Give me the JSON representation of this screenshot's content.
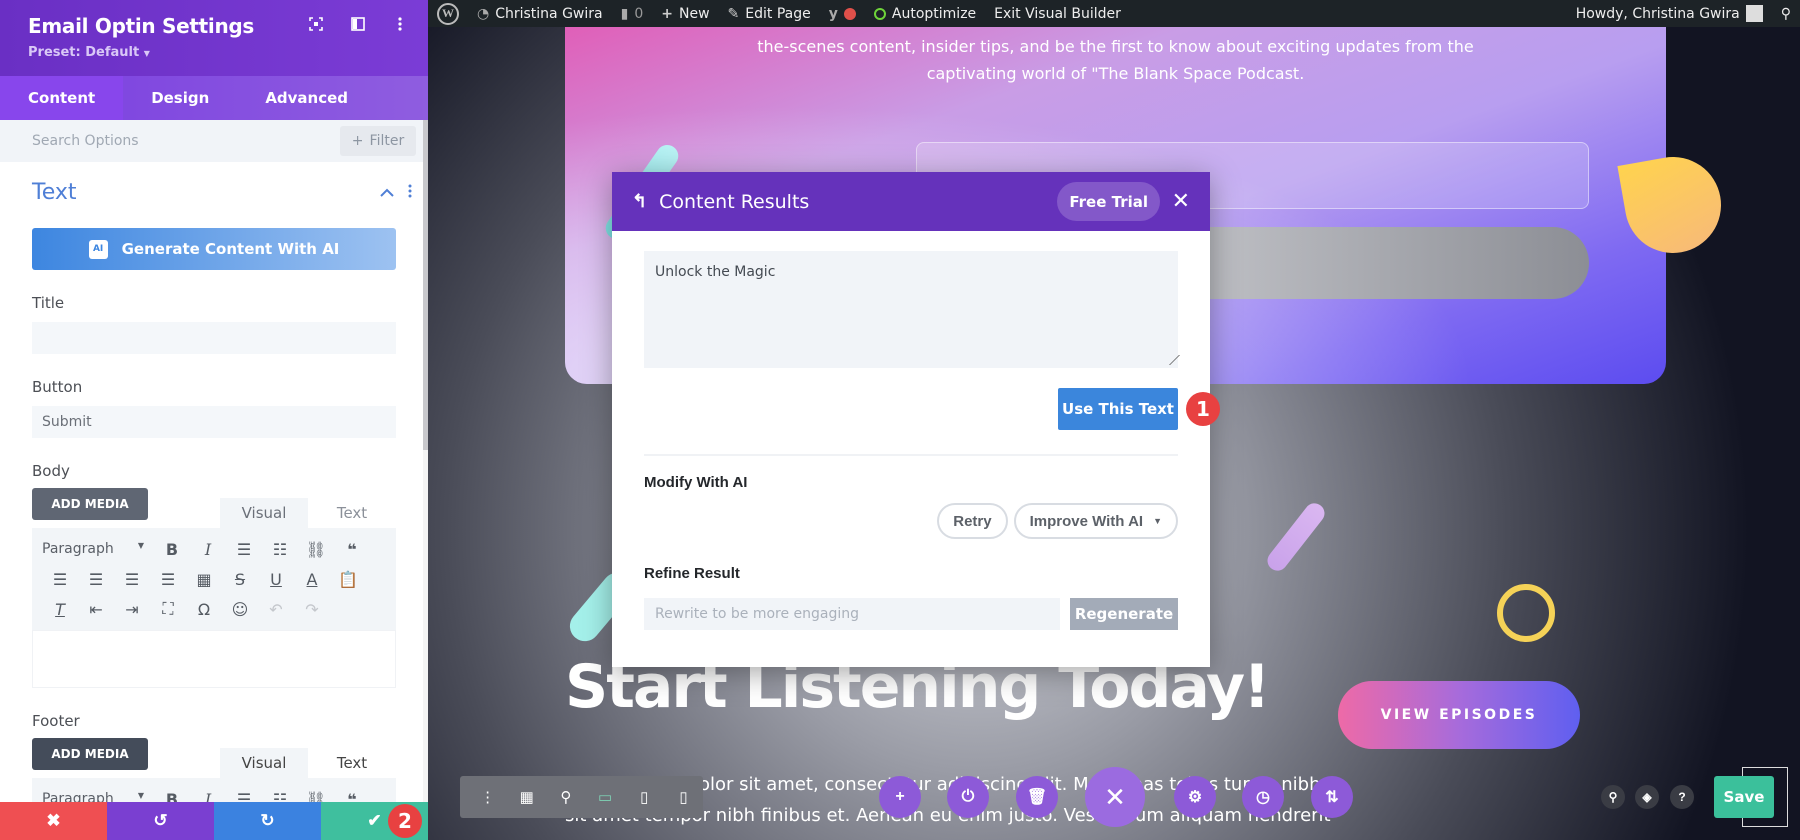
{
  "panel": {
    "title": "Email Optin Settings",
    "preset": "Preset: Default",
    "header_icons": [
      "focus-icon",
      "sidebar-toggle-icon",
      "more-vertical-icon"
    ],
    "tabs": [
      {
        "label": "Content",
        "active": true
      },
      {
        "label": "Design",
        "active": false
      },
      {
        "label": "Advanced",
        "active": false
      }
    ],
    "search_placeholder": "Search Options",
    "filter_label": "Filter",
    "section_title": "Text",
    "ai_button_label": "Generate Content With AI",
    "ai_badge": "AI",
    "fields": {
      "title_label": "Title",
      "title_value": "",
      "button_label": "Button",
      "button_value": "Submit",
      "body_label": "Body",
      "footer_label": "Footer"
    },
    "add_media_label": "ADD MEDIA",
    "editor_tabs": [
      "Visual",
      "Text"
    ],
    "paragraph_select": "Paragraph",
    "bottom_bar": {
      "discard": "✖",
      "undo": "↺",
      "redo": "↻",
      "save": "✔",
      "step_badge": "2"
    }
  },
  "adminbar": {
    "site_name": "Christina Gwira",
    "comments_count": "0",
    "new_label": "New",
    "edit_page_label": "Edit Page",
    "autoptimize_label": "Autoptimize",
    "exit_builder_label": "Exit Visual Builder",
    "greeting": "Howdy, Christina Gwira"
  },
  "page": {
    "hero_text_line1": "the-scenes content, insider tips, and be the first to know about exciting updates from the",
    "hero_text_line2": "captivating world of \"The Blank Space Podcast.",
    "headline": "Start Listening Today!",
    "body_line1": "Lorem ipsum dolor sit amet, consectetur adipiscing elit. Maecenas tellus turpis nibh",
    "body_line2": "sit amet tempor nibh finibus et. Aenean eu enim justo. Vestibulum aliquam hendrerit",
    "view_episodes": "VIEW EPISODES",
    "save_label": "Save"
  },
  "modal": {
    "title": "Content Results",
    "free_trial": "Free Trial",
    "result_text": "Unlock the Magic",
    "use_text_button": "Use This Text",
    "step_badge": "1",
    "modify_label": "Modify With AI",
    "retry_label": "Retry",
    "improve_label": "Improve With AI",
    "refine_label": "Refine Result",
    "refine_placeholder": "Rewrite to be more engaging",
    "regenerate_label": "Regenerate"
  }
}
